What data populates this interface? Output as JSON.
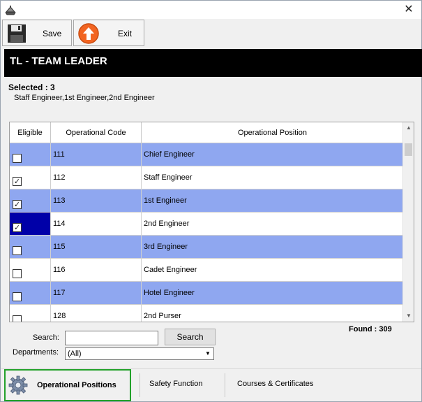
{
  "window": {
    "close_glyph": "✕"
  },
  "toolbar": {
    "save_label": "Save",
    "exit_label": "Exit"
  },
  "header": {
    "title": "TL - TEAM LEADER"
  },
  "selection": {
    "count_label": "Selected : 3",
    "list": "Staff Engineer,1st Engineer,2nd Engineer"
  },
  "grid": {
    "columns": [
      "Eligible",
      "Operational Code",
      "Operational Position"
    ],
    "rows": [
      {
        "checked": false,
        "code": "111",
        "position": "Chief Engineer",
        "style": "blue"
      },
      {
        "checked": true,
        "code": "112",
        "position": "Staff Engineer",
        "style": "white"
      },
      {
        "checked": true,
        "code": "113",
        "position": "1st Engineer",
        "style": "blue"
      },
      {
        "checked": true,
        "code": "114",
        "position": "2nd Engineer",
        "style": "white",
        "focused": true
      },
      {
        "checked": false,
        "code": "115",
        "position": "3rd Engineer",
        "style": "blue"
      },
      {
        "checked": false,
        "code": "116",
        "position": "Cadet Engineer",
        "style": "white"
      },
      {
        "checked": false,
        "code": "117",
        "position": "Hotel Engineer",
        "style": "blue"
      },
      {
        "checked": false,
        "code": "128",
        "position": "2nd Purser",
        "style": "white"
      }
    ]
  },
  "search": {
    "label": "Search:",
    "value": "",
    "button": "Search"
  },
  "departments": {
    "label": "Departments:",
    "selected": "(All)"
  },
  "found": "Found : 309",
  "tabs": {
    "operational": "Operational Positions",
    "safety": "Safety Function",
    "courses": "Courses & Certificates"
  },
  "colors": {
    "row_highlight": "#8fa7f0",
    "focus_cell": "#0000a8",
    "active_tab_border": "#22a12a",
    "header_bg": "#000000"
  },
  "icons": {
    "app": "ship-icon",
    "save": "floppy-disk-icon",
    "exit": "up-arrow-circle-icon",
    "tab": "gear-icon"
  }
}
